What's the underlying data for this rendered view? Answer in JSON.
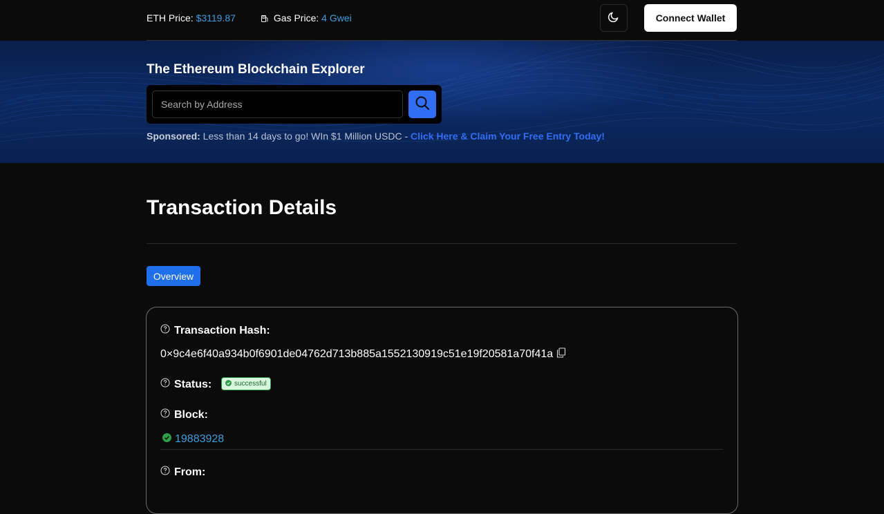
{
  "header": {
    "eth_price_label": "ETH Price:",
    "eth_price_value": "$3119.87",
    "gas_price_label": "Gas Price:",
    "gas_price_value": "4 Gwei",
    "connect_wallet_label": "Connect Wallet",
    "accent_color": "#3b9de0"
  },
  "hero": {
    "title": "The Ethereum Blockchain Explorer",
    "search_placeholder": "Search by Address",
    "sponsored_label": "Sponsored:",
    "sponsored_text": "Less than 14 days to go! WIn $1 Million USDC - ",
    "sponsored_link": "Click Here & Claim Your Free Entry Today!"
  },
  "main": {
    "page_title": "Transaction Details",
    "tabs": [
      {
        "label": "Overview",
        "active": true
      }
    ]
  },
  "transaction": {
    "hash_label": "Transaction Hash:",
    "hash_value": "0×9c4e6f40a934b0f6901de04762d713b885a1552130919c51e19f20581a70f41a",
    "status_label": "Status:",
    "status_value": "successful",
    "block_label": "Block:",
    "block_value": "19883928",
    "from_label": "From:"
  },
  "icons": {
    "gas": "fuel-pump-icon",
    "theme": "moon-icon",
    "search": "search-icon",
    "help": "help-circle-icon",
    "copy": "copy-icon",
    "check": "check-circle-icon"
  }
}
